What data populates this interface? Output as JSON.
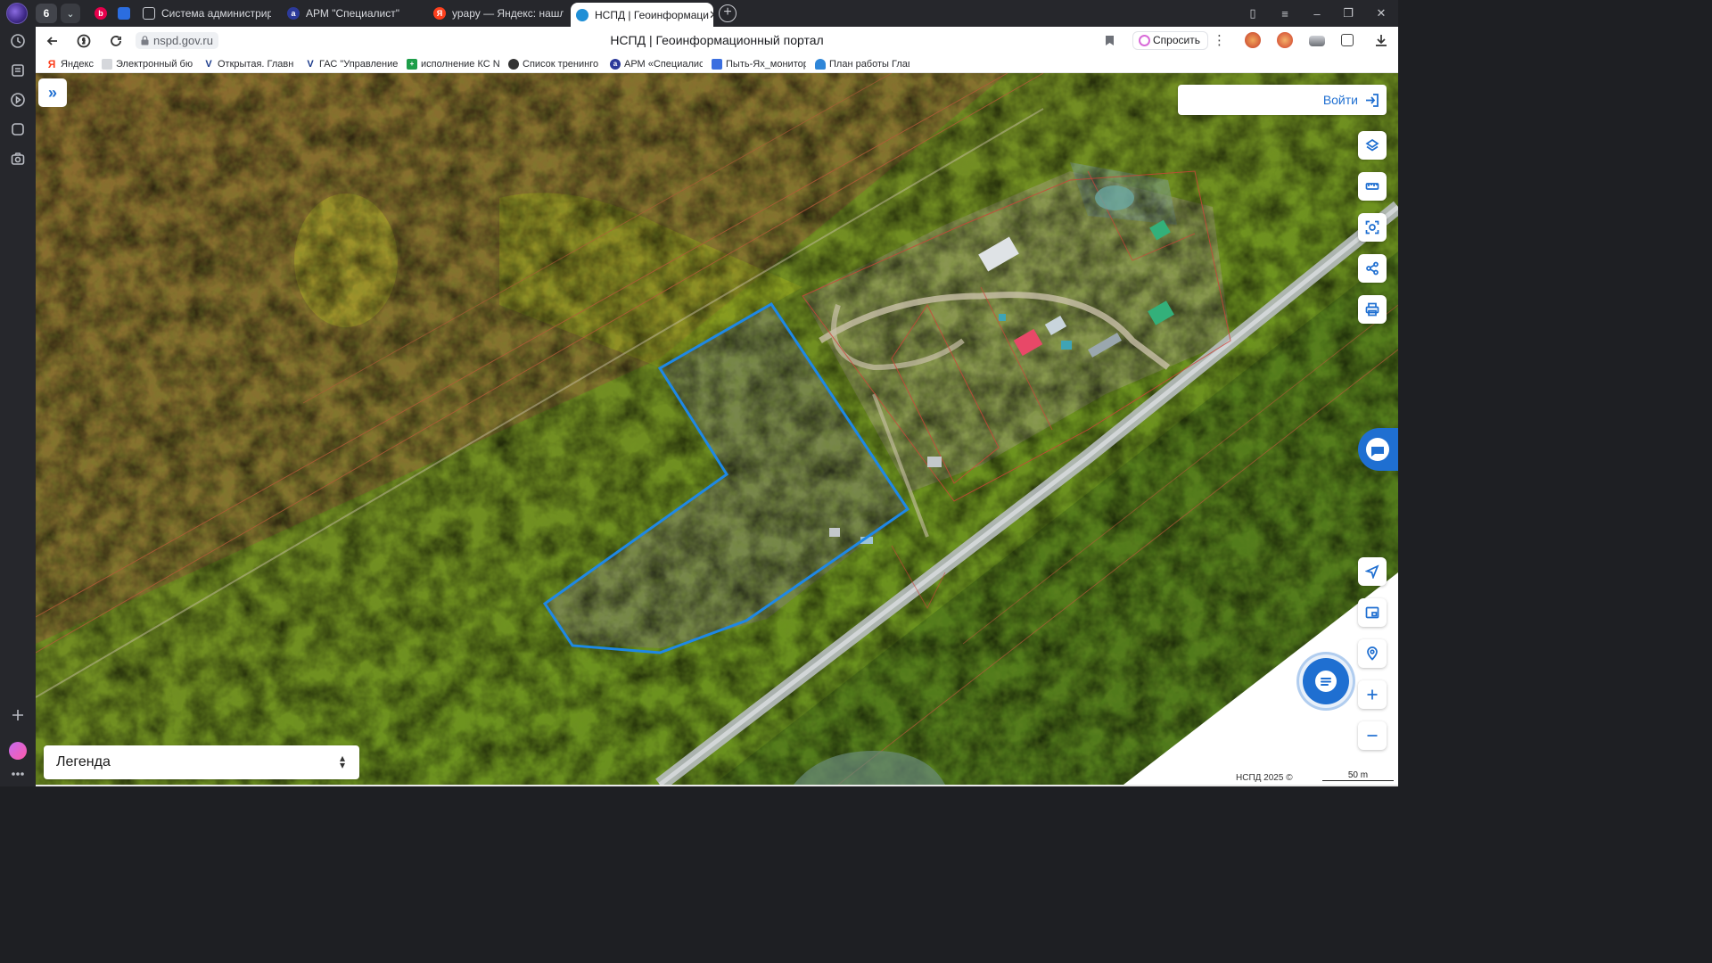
{
  "browser": {
    "tab_count": "6",
    "tabs": [
      {
        "title": "Система администриров",
        "favicon": "page-icon"
      },
      {
        "title": "АРМ \"Специалист\"",
        "favicon": "arm-icon"
      },
      {
        "title": "урару — Яндекс: нашлос",
        "favicon": "yandex-icon"
      },
      {
        "title": "НСПД | Геоинформаци",
        "favicon": "nspd-icon"
      }
    ],
    "url": "nspd.gov.ru",
    "page_title": "НСПД | Геоинформационный портал",
    "ask_label": "Спросить",
    "bookmarks": [
      {
        "label": "Яндекс",
        "icon": "yandex-icon",
        "color": "#fc3f1d"
      },
      {
        "label": "Электронный бю",
        "icon": "page-icon",
        "color": "#8a8f99"
      },
      {
        "label": "Открытая. Главн",
        "icon": "v-icon",
        "color": "#1a3a8a"
      },
      {
        "label": "ГАС \"Управление",
        "icon": "v-icon",
        "color": "#1a3a8a"
      },
      {
        "label": "исполнение КС N",
        "icon": "sheet-icon",
        "color": "#1e9e4a"
      },
      {
        "label": "Список тренинго",
        "icon": "circle-icon",
        "color": "#333333"
      },
      {
        "label": "АРМ «Специалис",
        "icon": "arm-icon",
        "color": "#2c3a9a"
      },
      {
        "label": "Пыть-Ях_монитор",
        "icon": "docs-icon",
        "color": "#3b6fe0"
      },
      {
        "label": "План работы Глав",
        "icon": "cloud-icon",
        "color": "#2f86d8"
      }
    ]
  },
  "map": {
    "login_label": "Войти",
    "legend_label": "Легенда",
    "footer_copyright": "НСПД 2025 ©",
    "scale_label": "50 m",
    "accent_color": "#1f6fd1",
    "parcel_color": "#1e88e5",
    "right_controls_top": [
      "layers-icon",
      "ruler-icon",
      "select-area-icon",
      "share-icon",
      "print-icon"
    ],
    "right_controls_bottom": [
      "navigate-icon",
      "overview-icon",
      "locate-icon",
      "zoom-in-icon",
      "zoom-out-icon"
    ]
  }
}
